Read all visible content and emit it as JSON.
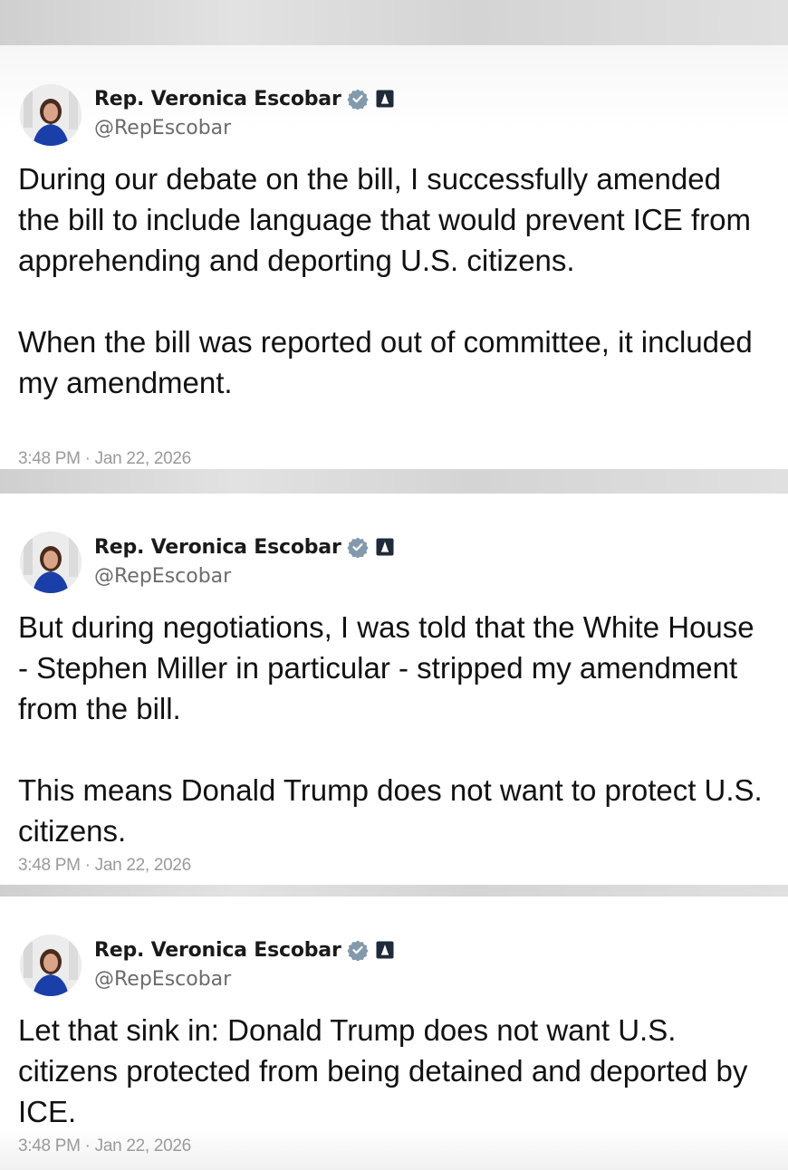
{
  "tweets": [
    {
      "display_name": "Rep. Veronica Escobar",
      "handle": "@RepEscobar",
      "paragraphs": [
        "During our debate on the bill, I successfully amended the bill to include language that would prevent ICE from apprehending and deporting U.S. citizens.",
        "When the bill was reported out of committee, it included my amendment."
      ],
      "timestamp": "3:48 PM · Jan 22, 2026"
    },
    {
      "display_name": "Rep. Veronica Escobar",
      "handle": "@RepEscobar",
      "paragraphs": [
        "But during negotiations, I was told that the White House - Stephen Miller in particular - stripped my amendment from the bill.",
        "This means Donald Trump does not want to protect U.S. citizens."
      ],
      "timestamp": "3:48 PM · Jan 22, 2026"
    },
    {
      "display_name": "Rep. Veronica Escobar",
      "handle": "@RepEscobar",
      "paragraphs": [
        "Let that sink in: Donald Trump does not want U.S. citizens protected from being detained and deported by ICE."
      ],
      "timestamp": "3:48 PM · Jan 22, 2026"
    }
  ],
  "icons": {
    "verified": "verified-badge-icon",
    "government": "government-affiliation-icon"
  },
  "colors": {
    "verified_badge": "#829aab",
    "name": "#1a1a1a",
    "handle": "#6b6b6b",
    "timestamp": "#9a9a9a"
  }
}
